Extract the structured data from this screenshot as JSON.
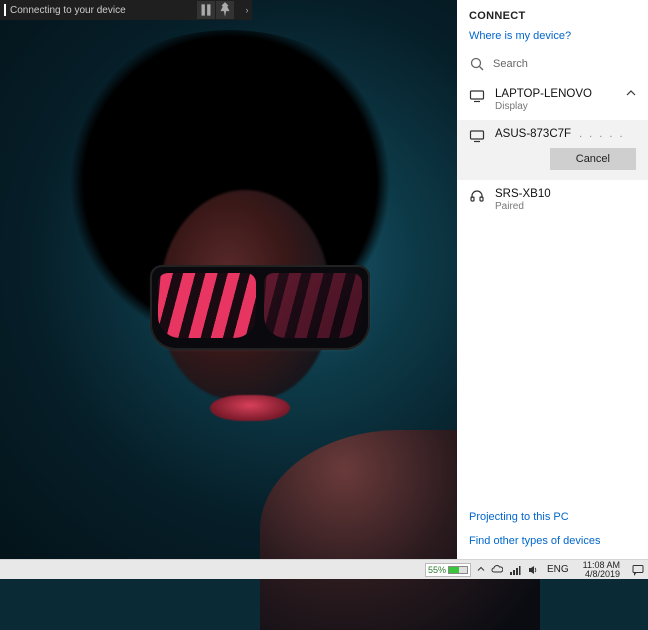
{
  "top_bar": {
    "title": "Connecting to your device",
    "pause_icon": "pause-icon",
    "pin_icon": "pin-icon",
    "caret": "›"
  },
  "panel": {
    "header": "CONNECT",
    "where_link": "Where is my device?",
    "search_label": "Search",
    "devices": [
      {
        "name": "LAPTOP-LENOVO",
        "sub": "Display",
        "type": "display",
        "expanded": true
      },
      {
        "name": "ASUS-873C7F",
        "sub": "",
        "type": "display",
        "connecting": true,
        "cancel_label": "Cancel",
        "dots": ". . . . ."
      },
      {
        "name": "SRS-XB10",
        "sub": "Paired",
        "type": "audio"
      }
    ],
    "projecting_link": "Projecting to this PC",
    "other_link": "Find other types of devices"
  },
  "taskbar": {
    "battery_pct": "55%",
    "lang": "ENG",
    "time": "11:08 AM",
    "date": "4/8/2019"
  }
}
